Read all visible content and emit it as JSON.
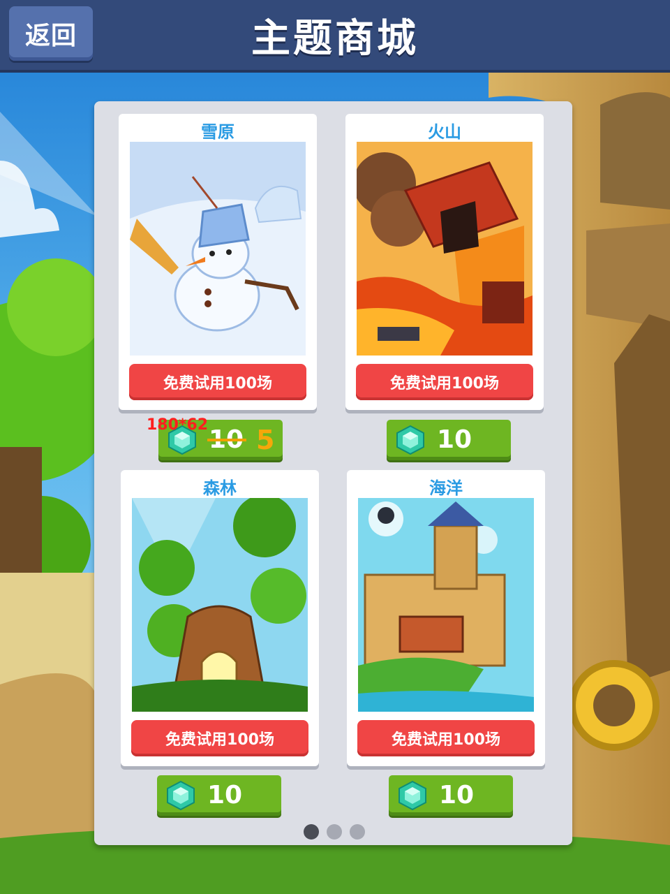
{
  "header": {
    "back_label": "返回",
    "title": "主题商城"
  },
  "themes": [
    {
      "name": "雪原",
      "trial_label": "免费试用100场",
      "price": "10",
      "sale_price": "5",
      "on_sale": true
    },
    {
      "name": "火山",
      "trial_label": "免费试用100场",
      "price": "10",
      "on_sale": false
    },
    {
      "name": "森林",
      "trial_label": "免费试用100场",
      "price": "10",
      "on_sale": false
    },
    {
      "name": "海洋",
      "trial_label": "免费试用100场",
      "price": "10",
      "on_sale": false
    }
  ],
  "annotation": {
    "size_note": "180*62"
  },
  "pagination": {
    "total": 3,
    "current": 1
  },
  "icons": {
    "back": "back-button",
    "currency": "gem-icon"
  },
  "colors": {
    "header": "#334a7a",
    "title_text": "#ffffff",
    "theme_name": "#2a9be3",
    "trial_button": "#f04545",
    "price_button": "#6eb622",
    "sale_price": "#f5a70a",
    "annotation": "#ff1f1f"
  }
}
